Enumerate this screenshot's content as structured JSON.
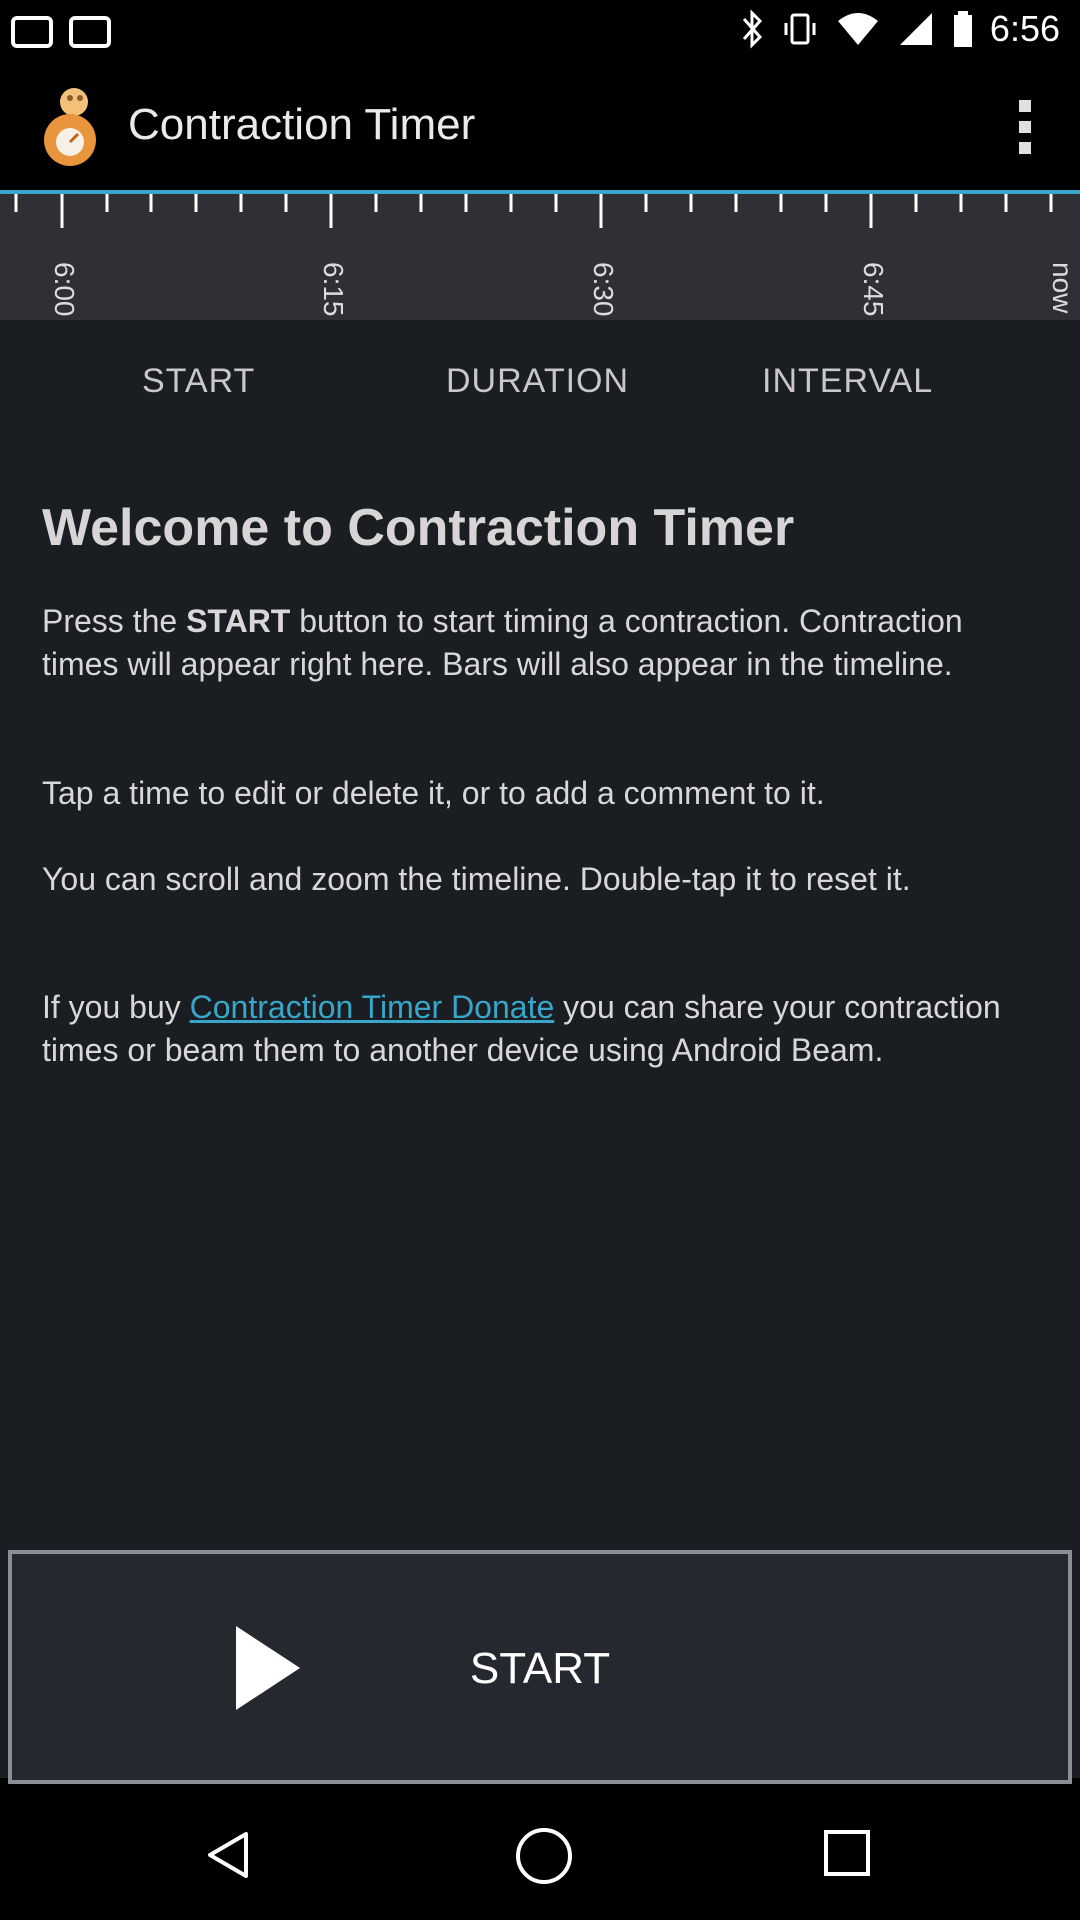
{
  "status_bar": {
    "time": "6:56",
    "icons": [
      "notification-icon",
      "notification-icon",
      "bluetooth-icon",
      "vibrate-icon",
      "wifi-icon",
      "signal-icon",
      "battery-icon"
    ]
  },
  "app_bar": {
    "title": "Contraction Timer",
    "logo_icon": "contraction-timer-logo-icon",
    "menu_icon": "overflow-menu-icon"
  },
  "timeline": {
    "ticks": [
      "6:00",
      "6:15",
      "6:30",
      "6:45",
      "now"
    ],
    "accent_color": "#37a6c9"
  },
  "columns": {
    "start": "START",
    "duration": "DURATION",
    "interval": "INTERVAL"
  },
  "welcome": {
    "title": "Welcome to Contraction Timer",
    "p1_prefix": "Press the ",
    "p1_bold": "START",
    "p1_suffix": " button to start timing a contraction. Contraction times will appear right here. Bars will also appear in the timeline.",
    "p2": "Tap a time to edit or delete it, or to add a comment to it.",
    "p3": "You can scroll and zoom the timeline. Double-tap it to reset it.",
    "p4_prefix": "If you buy ",
    "p4_link": "Contraction Timer Donate",
    "p4_suffix": " you can share your contraction times or beam them to another device using Android Beam."
  },
  "start_button": {
    "label": "START",
    "icon": "play-icon"
  },
  "nav_bar": {
    "back_icon": "back-icon",
    "home_icon": "home-icon",
    "recents_icon": "recents-icon"
  }
}
